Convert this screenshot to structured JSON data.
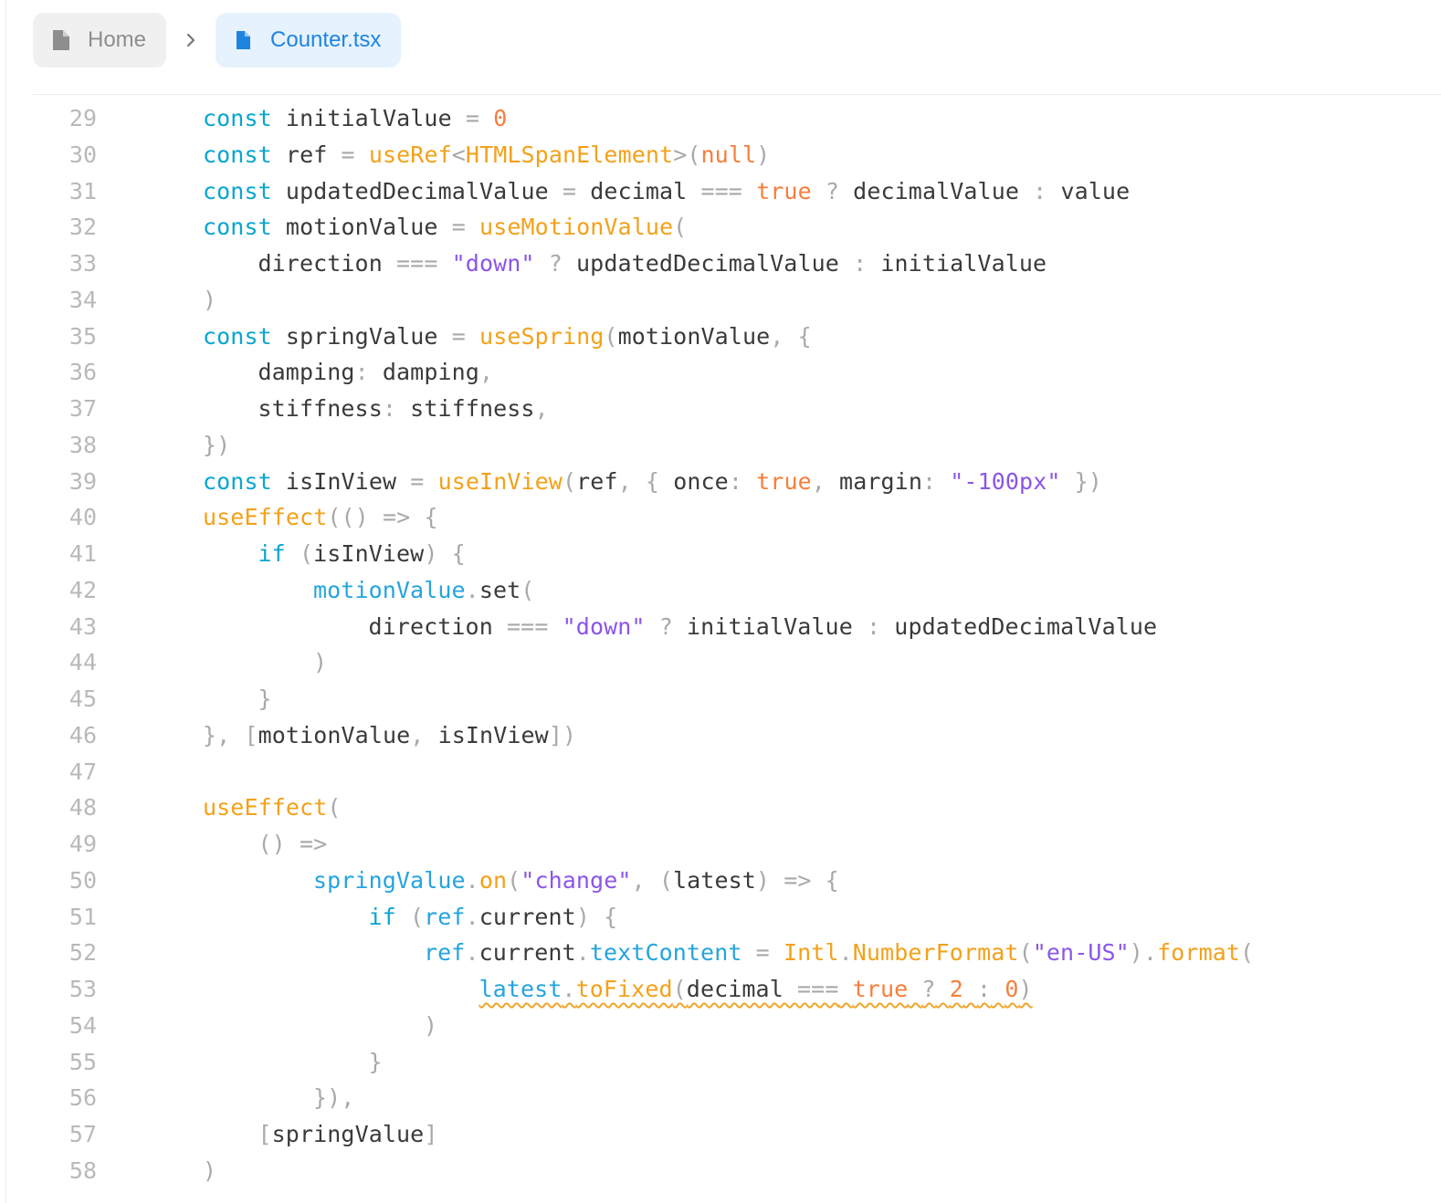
{
  "breadcrumb": {
    "home_label": "Home",
    "active_label": "Counter.tsx",
    "home_icon": "file-icon",
    "separator_icon": "chevron-right-icon",
    "active_icon": "file-icon",
    "accent_color": "#1e84e0"
  },
  "editor": {
    "lines": [
      {
        "n": "29",
        "indent": 0,
        "tokens": [
          [
            "kw",
            "const"
          ],
          [
            "idt",
            " initialValue "
          ],
          [
            "pn",
            "="
          ],
          [
            "idt",
            " "
          ],
          [
            "num",
            "0"
          ]
        ]
      },
      {
        "n": "30",
        "indent": 0,
        "tokens": [
          [
            "kw",
            "const"
          ],
          [
            "idt",
            " ref "
          ],
          [
            "pn",
            "="
          ],
          [
            "idt",
            " "
          ],
          [
            "fn",
            "useRef"
          ],
          [
            "pn",
            "<"
          ],
          [
            "fn",
            "HTMLSpanElement"
          ],
          [
            "pn",
            ">("
          ],
          [
            "num",
            "null"
          ],
          [
            "pn",
            ")"
          ]
        ]
      },
      {
        "n": "31",
        "indent": 0,
        "tokens": [
          [
            "kw",
            "const"
          ],
          [
            "idt",
            " updatedDecimalValue "
          ],
          [
            "pn",
            "="
          ],
          [
            "idt",
            " decimal "
          ],
          [
            "pn",
            "==="
          ],
          [
            "idt",
            " "
          ],
          [
            "num",
            "true"
          ],
          [
            "idt",
            " "
          ],
          [
            "pn",
            "?"
          ],
          [
            "idt",
            " decimalValue "
          ],
          [
            "pn",
            ":"
          ],
          [
            "idt",
            " value"
          ]
        ]
      },
      {
        "n": "32",
        "indent": 0,
        "tokens": [
          [
            "kw",
            "const"
          ],
          [
            "idt",
            " motionValue "
          ],
          [
            "pn",
            "="
          ],
          [
            "idt",
            " "
          ],
          [
            "fn",
            "useMotionValue"
          ],
          [
            "pn",
            "("
          ]
        ]
      },
      {
        "n": "33",
        "indent": 1,
        "tokens": [
          [
            "idt",
            "direction "
          ],
          [
            "pn",
            "==="
          ],
          [
            "idt",
            " "
          ],
          [
            "str",
            "\"down\""
          ],
          [
            "idt",
            " "
          ],
          [
            "pn",
            "?"
          ],
          [
            "idt",
            " updatedDecimalValue "
          ],
          [
            "pn",
            ":"
          ],
          [
            "idt",
            " initialValue"
          ]
        ]
      },
      {
        "n": "34",
        "indent": 0,
        "tokens": [
          [
            "pn",
            ")"
          ]
        ]
      },
      {
        "n": "35",
        "indent": 0,
        "tokens": [
          [
            "kw",
            "const"
          ],
          [
            "idt",
            " springValue "
          ],
          [
            "pn",
            "="
          ],
          [
            "idt",
            " "
          ],
          [
            "fn",
            "useSpring"
          ],
          [
            "pn",
            "("
          ],
          [
            "idt",
            "motionValue"
          ],
          [
            "pn",
            ","
          ],
          [
            "idt",
            " "
          ],
          [
            "pn",
            "{"
          ]
        ]
      },
      {
        "n": "36",
        "indent": 1,
        "tokens": [
          [
            "idt",
            "damping"
          ],
          [
            "pn",
            ":"
          ],
          [
            "idt",
            " damping"
          ],
          [
            "pn",
            ","
          ]
        ]
      },
      {
        "n": "37",
        "indent": 1,
        "tokens": [
          [
            "idt",
            "stiffness"
          ],
          [
            "pn",
            ":"
          ],
          [
            "idt",
            " stiffness"
          ],
          [
            "pn",
            ","
          ]
        ]
      },
      {
        "n": "38",
        "indent": 0,
        "tokens": [
          [
            "pn",
            "})"
          ]
        ]
      },
      {
        "n": "39",
        "indent": 0,
        "tokens": [
          [
            "kw",
            "const"
          ],
          [
            "idt",
            " isInView "
          ],
          [
            "pn",
            "="
          ],
          [
            "idt",
            " "
          ],
          [
            "fn",
            "useInView"
          ],
          [
            "pn",
            "("
          ],
          [
            "idt",
            "ref"
          ],
          [
            "pn",
            ","
          ],
          [
            "idt",
            " "
          ],
          [
            "pn",
            "{"
          ],
          [
            "idt",
            " once"
          ],
          [
            "pn",
            ":"
          ],
          [
            "idt",
            " "
          ],
          [
            "num",
            "true"
          ],
          [
            "pn",
            ","
          ],
          [
            "idt",
            " margin"
          ],
          [
            "pn",
            ":"
          ],
          [
            "idt",
            " "
          ],
          [
            "str",
            "\"-100px\""
          ],
          [
            "idt",
            " "
          ],
          [
            "pn",
            "})"
          ]
        ]
      },
      {
        "n": "40",
        "indent": 0,
        "tokens": [
          [
            "fn",
            "useEffect"
          ],
          [
            "pn",
            "(()"
          ],
          [
            "idt",
            " "
          ],
          [
            "pn",
            "=>"
          ],
          [
            "idt",
            " "
          ],
          [
            "pn",
            "{"
          ]
        ]
      },
      {
        "n": "41",
        "indent": 1,
        "tokens": [
          [
            "kw",
            "if"
          ],
          [
            "idt",
            " "
          ],
          [
            "pn",
            "("
          ],
          [
            "idt",
            "isInView"
          ],
          [
            "pn",
            ")"
          ],
          [
            "idt",
            " "
          ],
          [
            "pn",
            "{"
          ]
        ]
      },
      {
        "n": "42",
        "indent": 2,
        "tokens": [
          [
            "vb",
            "motionValue"
          ],
          [
            "pn",
            "."
          ],
          [
            "idt",
            "set"
          ],
          [
            "pn",
            "("
          ]
        ]
      },
      {
        "n": "43",
        "indent": 3,
        "tokens": [
          [
            "idt",
            "direction "
          ],
          [
            "pn",
            "==="
          ],
          [
            "idt",
            " "
          ],
          [
            "str",
            "\"down\""
          ],
          [
            "idt",
            " "
          ],
          [
            "pn",
            "?"
          ],
          [
            "idt",
            " initialValue "
          ],
          [
            "pn",
            ":"
          ],
          [
            "idt",
            " updatedDecimalValue"
          ]
        ]
      },
      {
        "n": "44",
        "indent": 2,
        "tokens": [
          [
            "pn",
            ")"
          ]
        ]
      },
      {
        "n": "45",
        "indent": 1,
        "tokens": [
          [
            "pn",
            "}"
          ]
        ]
      },
      {
        "n": "46",
        "indent": 0,
        "tokens": [
          [
            "pn",
            "},"
          ],
          [
            "idt",
            " "
          ],
          [
            "pn",
            "["
          ],
          [
            "idt",
            "motionValue"
          ],
          [
            "pn",
            ","
          ],
          [
            "idt",
            " isInView"
          ],
          [
            "pn",
            "])"
          ]
        ]
      },
      {
        "n": "47",
        "indent": 0,
        "tokens": []
      },
      {
        "n": "48",
        "indent": 0,
        "tokens": [
          [
            "fn",
            "useEffect"
          ],
          [
            "pn",
            "("
          ]
        ]
      },
      {
        "n": "49",
        "indent": 1,
        "tokens": [
          [
            "pn",
            "()"
          ],
          [
            "idt",
            " "
          ],
          [
            "pn",
            "=>"
          ]
        ]
      },
      {
        "n": "50",
        "indent": 2,
        "tokens": [
          [
            "vb",
            "springValue"
          ],
          [
            "pn",
            "."
          ],
          [
            "fn",
            "on"
          ],
          [
            "pn",
            "("
          ],
          [
            "str",
            "\"change\""
          ],
          [
            "pn",
            ","
          ],
          [
            "idt",
            " "
          ],
          [
            "pn",
            "("
          ],
          [
            "idt",
            "latest"
          ],
          [
            "pn",
            ")"
          ],
          [
            "idt",
            " "
          ],
          [
            "pn",
            "=>"
          ],
          [
            "idt",
            " "
          ],
          [
            "pn",
            "{"
          ]
        ]
      },
      {
        "n": "51",
        "indent": 3,
        "tokens": [
          [
            "kw",
            "if"
          ],
          [
            "idt",
            " "
          ],
          [
            "pn",
            "("
          ],
          [
            "vb",
            "ref"
          ],
          [
            "pn",
            "."
          ],
          [
            "idt",
            "current"
          ],
          [
            "pn",
            ")"
          ],
          [
            "idt",
            " "
          ],
          [
            "pn",
            "{"
          ]
        ]
      },
      {
        "n": "52",
        "indent": 4,
        "tokens": [
          [
            "vb",
            "ref"
          ],
          [
            "pn",
            "."
          ],
          [
            "idt",
            "current"
          ],
          [
            "pn",
            "."
          ],
          [
            "vb",
            "textContent"
          ],
          [
            "idt",
            " "
          ],
          [
            "pn",
            "="
          ],
          [
            "idt",
            " "
          ],
          [
            "fn",
            "Intl"
          ],
          [
            "pn",
            "."
          ],
          [
            "fn",
            "NumberFormat"
          ],
          [
            "pn",
            "("
          ],
          [
            "str",
            "\"en-US\""
          ],
          [
            "pn",
            ")."
          ],
          [
            "fn",
            "format"
          ],
          [
            "pn",
            "("
          ]
        ]
      },
      {
        "n": "53",
        "indent": 5,
        "squiggle": true,
        "tokens": [
          [
            "vb",
            "latest"
          ],
          [
            "pn",
            "."
          ],
          [
            "fn",
            "toFixed"
          ],
          [
            "pn",
            "("
          ],
          [
            "idt",
            "decimal "
          ],
          [
            "pn",
            "==="
          ],
          [
            "idt",
            " "
          ],
          [
            "num",
            "true"
          ],
          [
            "idt",
            " "
          ],
          [
            "pn",
            "?"
          ],
          [
            "idt",
            " "
          ],
          [
            "num",
            "2"
          ],
          [
            "idt",
            " "
          ],
          [
            "pn",
            ":"
          ],
          [
            "idt",
            " "
          ],
          [
            "num",
            "0"
          ],
          [
            "pn",
            ")"
          ]
        ]
      },
      {
        "n": "54",
        "indent": 4,
        "tokens": [
          [
            "pn",
            ")"
          ]
        ]
      },
      {
        "n": "55",
        "indent": 3,
        "tokens": [
          [
            "pn",
            "}"
          ]
        ]
      },
      {
        "n": "56",
        "indent": 2,
        "tokens": [
          [
            "pn",
            "}),"
          ]
        ]
      },
      {
        "n": "57",
        "indent": 1,
        "tokens": [
          [
            "pn",
            "["
          ],
          [
            "idt",
            "springValue"
          ],
          [
            "pn",
            "]"
          ]
        ]
      },
      {
        "n": "58",
        "indent": 0,
        "tokens": [
          [
            "pn",
            ")"
          ]
        ]
      }
    ]
  }
}
